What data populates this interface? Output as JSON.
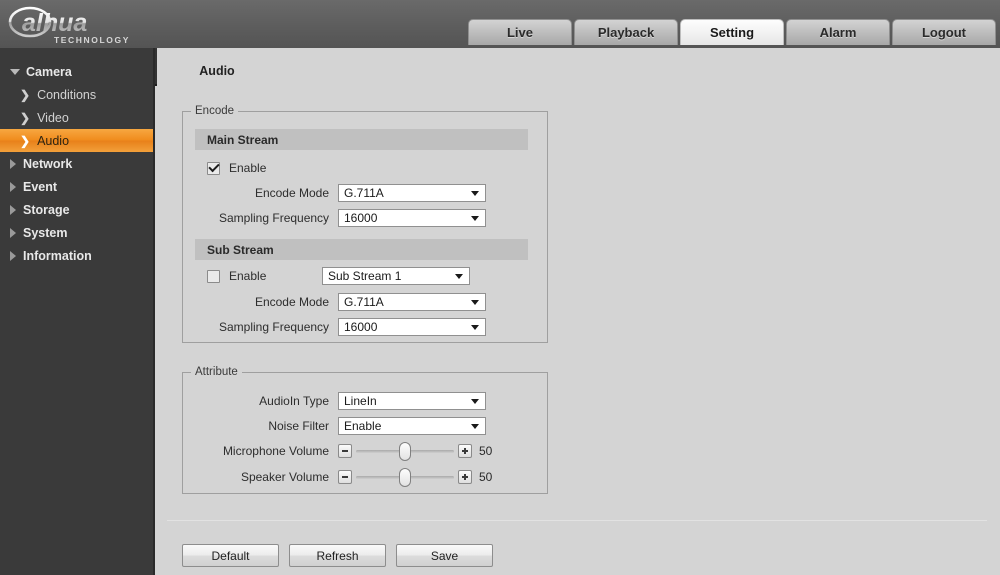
{
  "header": {
    "logo_text": "alhua",
    "logo_subtext": "TECHNOLOGY",
    "nav_tabs": [
      {
        "label": "Live",
        "active": false
      },
      {
        "label": "Playback",
        "active": false
      },
      {
        "label": "Setting",
        "active": true
      },
      {
        "label": "Alarm",
        "active": false
      },
      {
        "label": "Logout",
        "active": false
      }
    ],
    "help_icon": "question-mark-icon",
    "help_label": "?"
  },
  "sidebar": {
    "items": [
      {
        "label": "Camera",
        "level": "group",
        "expanded": true,
        "active": false,
        "icon": "triangle-down-icon"
      },
      {
        "label": "Conditions",
        "level": "sub",
        "expanded": false,
        "active": false,
        "icon": "chevron-right-icon"
      },
      {
        "label": "Video",
        "level": "sub",
        "expanded": false,
        "active": false,
        "icon": "chevron-right-icon"
      },
      {
        "label": "Audio",
        "level": "sub",
        "expanded": false,
        "active": true,
        "icon": "chevron-right-icon"
      },
      {
        "label": "Network",
        "level": "group",
        "expanded": false,
        "active": false,
        "icon": "triangle-right-icon"
      },
      {
        "label": "Event",
        "level": "group",
        "expanded": false,
        "active": false,
        "icon": "triangle-right-icon"
      },
      {
        "label": "Storage",
        "level": "group",
        "expanded": false,
        "active": false,
        "icon": "triangle-right-icon"
      },
      {
        "label": "System",
        "level": "group",
        "expanded": false,
        "active": false,
        "icon": "triangle-right-icon"
      },
      {
        "label": "Information",
        "level": "group",
        "expanded": false,
        "active": false,
        "icon": "triangle-right-icon"
      }
    ]
  },
  "content": {
    "subtab": {
      "label": "Audio",
      "active": true
    },
    "encode": {
      "legend": "Encode",
      "main_stream": {
        "title": "Main Stream",
        "enable_label": "Enable",
        "enable_checked": true,
        "encode_mode_label": "Encode Mode",
        "encode_mode_value": "G.711A",
        "sampling_label": "Sampling Frequency",
        "sampling_value": "16000"
      },
      "sub_stream": {
        "title": "Sub Stream",
        "enable_label": "Enable",
        "enable_checked": false,
        "stream_select_value": "Sub Stream 1",
        "encode_mode_label": "Encode Mode",
        "encode_mode_value": "G.711A",
        "sampling_label": "Sampling Frequency",
        "sampling_value": "16000"
      }
    },
    "attribute": {
      "legend": "Attribute",
      "audioin_label": "AudioIn Type",
      "audioin_value": "LineIn",
      "noise_label": "Noise Filter",
      "noise_value": "Enable",
      "mic_label": "Microphone Volume",
      "mic_value": "50",
      "speaker_label": "Speaker Volume",
      "speaker_value": "50",
      "minus_icon": "minus-icon",
      "plus_icon": "plus-icon"
    },
    "buttons": [
      {
        "label": "Default"
      },
      {
        "label": "Refresh"
      },
      {
        "label": "Save"
      }
    ]
  },
  "colors": {
    "accent_orange": "#f08c1d",
    "header_gray": "#5d5d5d",
    "tabband_dark": "#333333",
    "sidebar_dark": "#3a3a3a",
    "content_bg": "#d4d4d4",
    "stream_head": "#c0c0c0"
  }
}
